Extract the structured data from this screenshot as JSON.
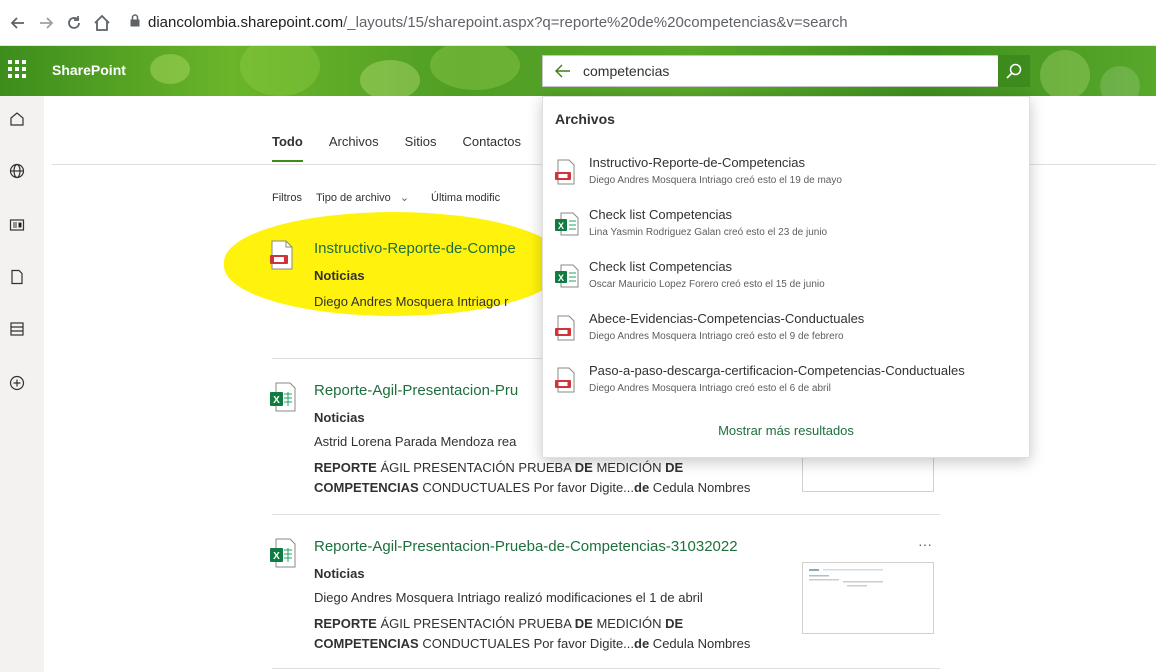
{
  "browser": {
    "url_host": "diancolombia.sharepoint.com",
    "url_path": "/_layouts/15/sharepoint.aspx?q=reporte%20de%20competencias&v=search"
  },
  "header": {
    "app_title": "SharePoint",
    "search_value": "competencias",
    "search_placeholder": "competencias"
  },
  "tabs": [
    "Todo",
    "Archivos",
    "Sitios",
    "Contactos"
  ],
  "filters": {
    "label": "Filtros",
    "type": "Tipo de archivo",
    "date": "Última modific"
  },
  "results": [
    {
      "title": "Instructivo-Reporte-de-Compe",
      "site": "Noticias",
      "meta_author": "Diego Andres Mosquera Intriago",
      "meta_rest": " r",
      "icon": "pdf-icon"
    },
    {
      "title": "Reporte-Agil-Presentacion-Pru",
      "site": "Noticias",
      "meta_author": "Astrid Lorena Parada Mendoza",
      "meta_rest": " rea",
      "snippet_line1_a": "REPORTE",
      "snippet_line1_b": " ÁGIL PRESENTACIÓN PRUEBA ",
      "snippet_line1_c": "DE",
      "snippet_line1_d": " MEDICIÓN ",
      "snippet_line1_e": "DE",
      "snippet_line2_a": "COMPETENCIAS",
      "snippet_line2_b": " CONDUCTUALES Por favor Digite...",
      "snippet_line2_c": "de",
      "snippet_line2_d": " Cedula Nombres",
      "icon": "excel-icon"
    },
    {
      "title": "Reporte-Agil-Presentacion-Prueba-de-Competencias-31032022",
      "site": "Noticias",
      "meta_author": "Diego Andres Mosquera Intriago",
      "meta_rest": " realizó modificaciones el 1 de abril",
      "snippet_line1_a": "REPORTE",
      "snippet_line1_b": " ÁGIL PRESENTACIÓN PRUEBA ",
      "snippet_line1_c": "DE",
      "snippet_line1_d": " MEDICIÓN ",
      "snippet_line1_e": "DE",
      "snippet_line2_a": "COMPETENCIAS",
      "snippet_line2_b": " CONDUCTUALES Por favor Digite...",
      "snippet_line2_c": "de",
      "snippet_line2_d": " Cedula Nombres",
      "more": "···",
      "icon": "excel-icon"
    }
  ],
  "dropdown": {
    "heading": "Archivos",
    "items": [
      {
        "name": "Instructivo-Reporte-de-Competencias",
        "sub": "Diego Andres Mosquera Intriago creó esto el 19 de mayo",
        "icon": "pdf-icon"
      },
      {
        "name": "Check list Competencias",
        "sub": "Lina Yasmin Rodriguez Galan creó esto el 23 de junio",
        "icon": "excel-icon"
      },
      {
        "name": "Check list Competencias",
        "sub": "Oscar Mauricio Lopez Forero creó esto el 15 de junio",
        "icon": "excel-icon"
      },
      {
        "name": "Abece-Evidencias-Competencias-Conductuales",
        "sub": "Diego Andres Mosquera Intriago creó esto el 9 de febrero",
        "icon": "pdf-icon"
      },
      {
        "name": "Paso-a-paso-descarga-certificacion-Competencias-Conductuales",
        "sub": "Diego Andres Mosquera Intriago creó esto el 6 de abril",
        "icon": "pdf-icon"
      }
    ],
    "more_label": "Mostrar más resultados"
  },
  "colors": {
    "accent": "#3d8a1d",
    "link": "#1e6f3d",
    "highlight": "#fff200"
  }
}
